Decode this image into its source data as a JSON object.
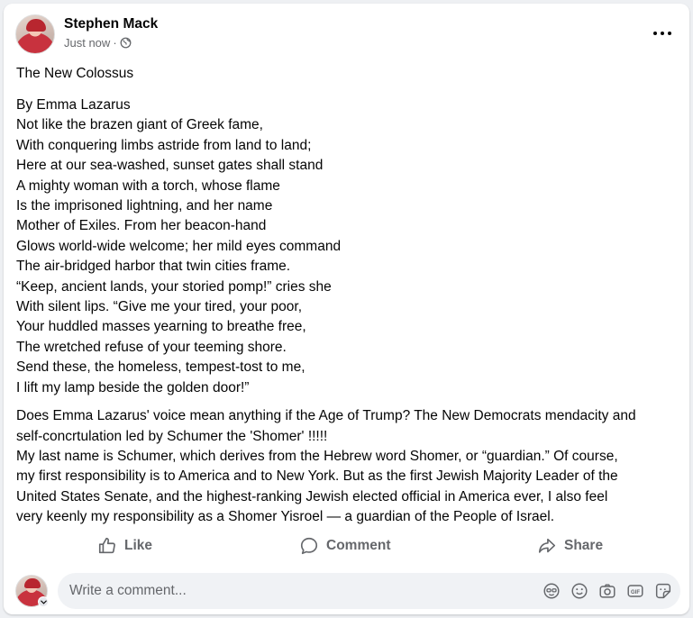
{
  "post": {
    "author": "Stephen Mack",
    "timestamp": "Just now",
    "separator": "·",
    "title": "The New Colossus",
    "poem_lines": [
      "By Emma Lazarus",
      "Not like the brazen giant of Greek fame,",
      "With conquering limbs astride from land to land;",
      "Here at our sea-washed, sunset gates shall stand",
      "A mighty woman with a torch, whose flame",
      "Is the imprisoned lightning, and her name",
      "Mother of Exiles. From her beacon-hand",
      "Glows world-wide welcome; her mild eyes command",
      "The air-bridged harbor that twin cities frame.",
      "“Keep, ancient lands, your storied pomp!” cries she",
      "With silent lips. “Give me your tired, your poor,",
      "Your huddled masses yearning to breathe free,",
      "The wretched refuse of your teeming shore.",
      "Send these, the homeless, tempest-tost to me,",
      "I lift my lamp beside the golden door!”"
    ],
    "commentary_lines": [
      "Does Emma Lazarus' voice mean anything if the Age of Trump? The New Democrats mendacity and",
      "self-concrtulation led by Schumer the 'Shomer' !!!!!",
      "My last name is Schumer, which derives from the Hebrew word Shomer, or “guardian.” Of course,",
      "my first responsibility is to America and to New York. But as the first Jewish Majority Leader of the",
      "United States Senate, and the highest-ranking Jewish elected official in America ever, I also feel",
      "very keenly my responsibility as a Shomer Yisroel — a guardian of the People of Israel."
    ]
  },
  "actions": {
    "like_label": "Like",
    "comment_label": "Comment",
    "share_label": "Share"
  },
  "composer": {
    "placeholder": "Write a comment..."
  },
  "icons": {
    "privacy": "globe-icon",
    "more": "more-options-icon",
    "like": "thumbs-up-icon",
    "comment": "speech-bubble-icon",
    "share": "share-arrow-icon",
    "avatar_sticker": "avatar-sticker-icon",
    "emoji": "emoji-icon",
    "camera": "camera-icon",
    "gif": "gif-icon",
    "sticker": "sticker-icon"
  },
  "colors": {
    "secondary_text": "#65676b",
    "input_bg": "#f0f2f5",
    "card_bg": "#ffffff"
  }
}
